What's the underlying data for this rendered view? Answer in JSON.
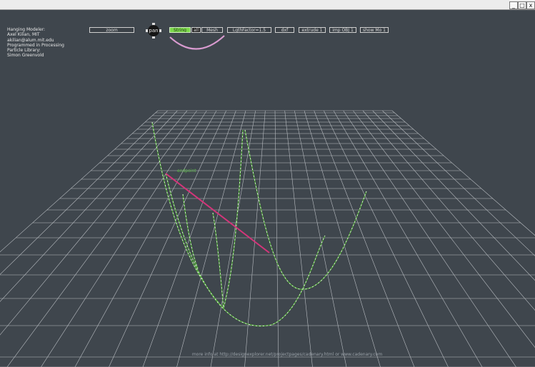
{
  "window": {
    "buttons": [
      "_",
      "□",
      "x"
    ]
  },
  "credits": [
    "Hanging Modeler:",
    "Axel Kilian, MIT",
    "akilian@alum.mit.edu",
    "Programmed in Processing",
    "Particle Library:",
    "Simon Greenvold"
  ],
  "toolbar": {
    "zoom": "zoom",
    "pan": "pan",
    "string": "String",
    "all": "all",
    "mesh": "Mesh",
    "lgth_factor": "LgthFactor=1.5",
    "dxf": "dxf",
    "extrude": "extrude 1",
    "imp_obj": "imp OBJ 1",
    "show_mo": "show Mo 1"
  },
  "viewport": {
    "endpoint_label": "endpoint",
    "colors": {
      "grid": "#b9bdc2",
      "curve": "#52a83a",
      "rod": "#d4357a",
      "preview": "#d99bd0"
    }
  },
  "footer": "more info at http://designexplorer.net/projectpages/cadenary.html or www.cadenary.com"
}
